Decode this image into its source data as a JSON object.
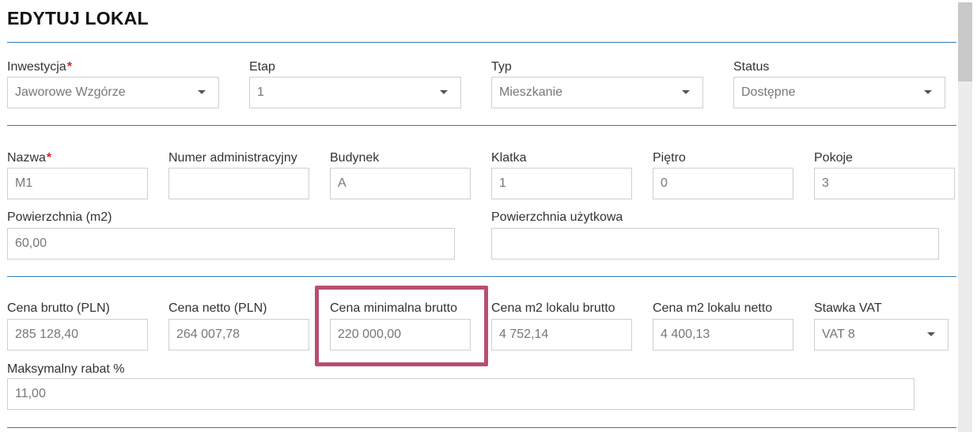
{
  "page": {
    "title": "EDYTUJ LOKAL",
    "required_mark": "*"
  },
  "section1": {
    "investment": {
      "label": "Inwestycja",
      "value": "Jaworowe Wzgórze",
      "required": true
    },
    "stage": {
      "label": "Etap",
      "value": "1"
    },
    "type": {
      "label": "Typ",
      "value": "Mieszkanie"
    },
    "status": {
      "label": "Status",
      "value": "Dostępne"
    }
  },
  "section2": {
    "name": {
      "label": "Nazwa",
      "value": "M1",
      "required": true
    },
    "admin_number": {
      "label": "Numer administracyjny",
      "value": ""
    },
    "building": {
      "label": "Budynek",
      "value": "A"
    },
    "staircase": {
      "label": "Klatka",
      "value": "1"
    },
    "floor": {
      "label": "Piętro",
      "value": "0"
    },
    "rooms": {
      "label": "Pokoje",
      "value": "3"
    },
    "area": {
      "label": "Powierzchnia (m2)",
      "value": "60,00"
    },
    "usable_area": {
      "label": "Powierzchnia użytkowa",
      "value": ""
    }
  },
  "section3": {
    "price_gross": {
      "label": "Cena brutto (PLN)",
      "value": "285 128,40"
    },
    "price_net": {
      "label": "Cena netto (PLN)",
      "value": "264 007,78"
    },
    "min_price_gross": {
      "label": "Cena minimalna brutto",
      "value": "220 000,00"
    },
    "price_m2_gross": {
      "label": "Cena m2 lokalu brutto",
      "value": "4 752,14"
    },
    "price_m2_net": {
      "label": "Cena m2 lokalu netto",
      "value": "4 400,13"
    },
    "vat_rate": {
      "label": "Stawka VAT",
      "value": "VAT 8"
    },
    "max_discount": {
      "label": "Maksymalny rabat %",
      "value": "11,00"
    }
  },
  "colors": {
    "accent_line": "#2f7cb8",
    "highlight": "#b94e6e",
    "required": "#e02020"
  }
}
